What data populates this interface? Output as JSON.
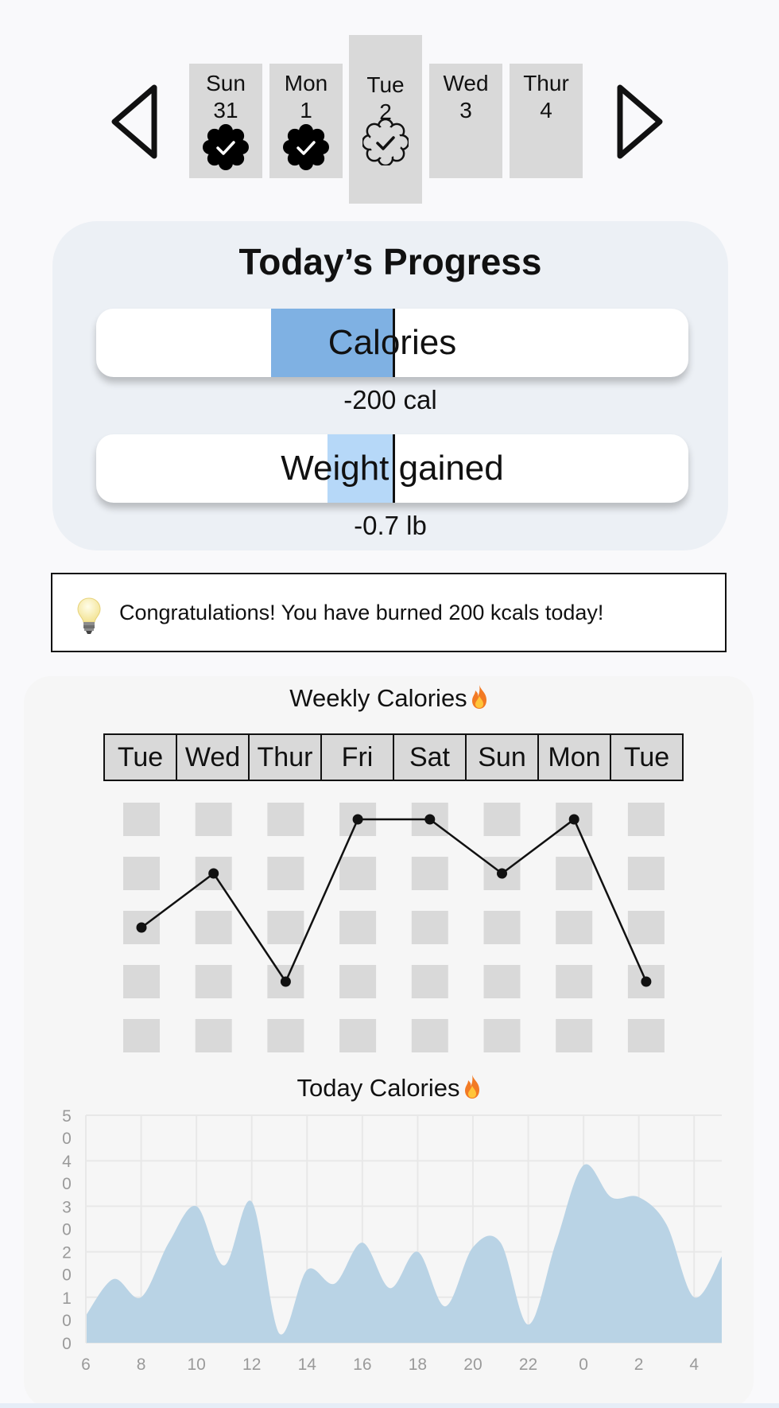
{
  "date_strip": {
    "days": [
      {
        "name": "Sun",
        "num": "31",
        "status": "completed"
      },
      {
        "name": "Mon",
        "num": "1",
        "status": "completed"
      },
      {
        "name": "Tue",
        "num": "2",
        "status": "pending",
        "selected": true
      },
      {
        "name": "Wed",
        "num": "3",
        "status": "none"
      },
      {
        "name": "Thur",
        "num": "4",
        "status": "none"
      }
    ],
    "prev_icon": "triangle-left-icon",
    "next_icon": "triangle-right-icon"
  },
  "progress": {
    "title": "Today’s Progress",
    "calories": {
      "label": "Calories",
      "value": "-200 cal",
      "fill_fraction": -0.41,
      "color": "#7fb1e3"
    },
    "weight": {
      "label": "Weight gained",
      "value": "-0.7 lb",
      "fill_fraction": -0.22,
      "color": "#b6d8f8"
    }
  },
  "notice": {
    "icon": "lightbulb-icon",
    "text": "Congratulations! You have burned 200 kcals today!"
  },
  "weekly": {
    "title": "Weekly Calories",
    "title_icon": "flame-icon",
    "days": [
      "Tue",
      "Wed",
      "Thur",
      "Fri",
      "Sat",
      "Sun",
      "Mon",
      "Tue"
    ],
    "levels": [
      3,
      4,
      2,
      5,
      5,
      4,
      5,
      2
    ],
    "rows": 5,
    "cell_color": "#d9d9d9"
  },
  "today": {
    "title": "Today Calories",
    "title_icon": "flame-icon",
    "chart_data": {
      "type": "area",
      "x_tick_labels": [
        "6",
        "8",
        "10",
        "12",
        "14",
        "16",
        "18",
        "20",
        "22",
        "0",
        "2",
        "4"
      ],
      "y_tick_labels": [
        [
          "5",
          "0"
        ],
        [
          "4",
          "0"
        ],
        [
          "3",
          "0"
        ],
        [
          "2",
          "0"
        ],
        [
          "1",
          "0"
        ],
        [
          "0"
        ]
      ],
      "ylim": [
        0,
        50
      ],
      "x": [
        6,
        7,
        8,
        9,
        10,
        11,
        12,
        13,
        14,
        15,
        16,
        17,
        18,
        19,
        20,
        21,
        22,
        23,
        24,
        25,
        26,
        27,
        28,
        29
      ],
      "values": [
        6,
        14,
        10,
        22,
        30,
        17,
        31,
        2,
        16,
        13,
        22,
        12,
        20,
        8,
        21,
        22,
        4,
        22,
        39,
        32,
        32,
        26,
        10,
        19
      ],
      "fill_color": "#b9d3e5",
      "grid": true
    }
  }
}
